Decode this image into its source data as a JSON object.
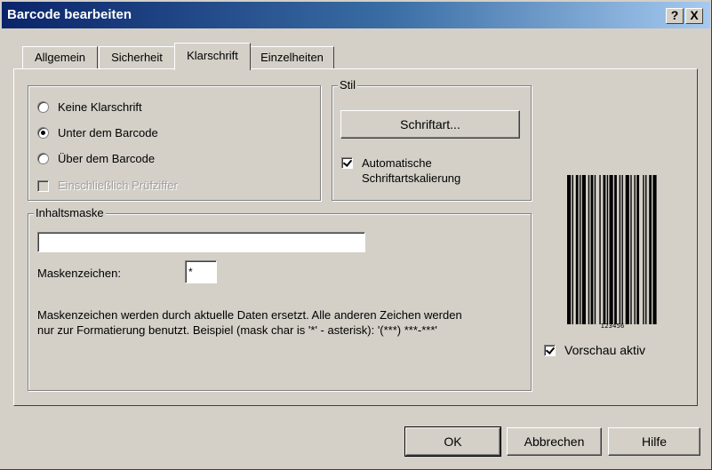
{
  "window": {
    "title": "Barcode bearbeiten"
  },
  "titlebar_buttons": {
    "help": "?",
    "close": "X"
  },
  "tabs": [
    {
      "label": "Allgemein"
    },
    {
      "label": "Sicherheit"
    },
    {
      "label": "Klarschrift"
    },
    {
      "label": "Einzelheiten"
    }
  ],
  "active_tab": "Klarschrift",
  "position_group": {
    "options": [
      {
        "label": "Keine Klarschrift",
        "checked": false
      },
      {
        "label": "Unter dem Barcode",
        "checked": true
      },
      {
        "label": "Über dem Barcode",
        "checked": false
      }
    ],
    "checksum_label": "Einschließlich Prüfziffer",
    "checksum_checked": false,
    "checksum_enabled": false
  },
  "style_group": {
    "title": "Stil",
    "font_button": "Schriftart...",
    "autoscale_label_line1": "Automatische",
    "autoscale_label_line2": "Schriftartskalierung",
    "autoscale_checked": true
  },
  "mask_group": {
    "title": "Inhaltsmaske",
    "mask_value": "",
    "mask_char_label": "Maskenzeichen:",
    "mask_char_value": "*",
    "description_line1": "Maskenzeichen werden durch aktuelle Daten ersetzt. Alle anderen Zeichen werden",
    "description_line2": "nur zur Formatierung benutzt. Beispiel (mask char is '*' - asterisk): '(***) ***-***'"
  },
  "preview": {
    "barcode_text": "123456",
    "preview_label": "Vorschau aktiv",
    "preview_checked": true
  },
  "footer": {
    "ok": "OK",
    "cancel": "Abbrechen",
    "help": "Hilfe"
  }
}
